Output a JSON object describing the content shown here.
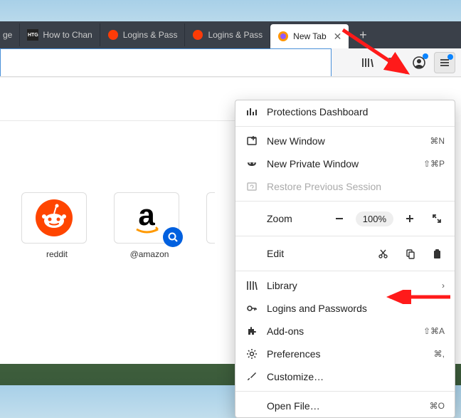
{
  "tabs": [
    {
      "label": "ge",
      "favicon": "generic"
    },
    {
      "label": "How to Chan",
      "favicon": "htg"
    },
    {
      "label": "Logins & Pass",
      "favicon": "firefox"
    },
    {
      "label": "Logins & Pass",
      "favicon": "firefox"
    },
    {
      "label": "New Tab",
      "favicon": "firefox-color",
      "active": true
    }
  ],
  "tiles": [
    {
      "label": "reddit",
      "icon": "reddit"
    },
    {
      "label": "@amazon",
      "icon": "amazon",
      "search": true
    }
  ],
  "zoom": {
    "label": "Zoom",
    "value": "100%"
  },
  "edit": {
    "label": "Edit"
  },
  "menu": {
    "protections": "Protections Dashboard",
    "new_window": {
      "label": "New Window",
      "shortcut": "⌘N"
    },
    "new_private": {
      "label": "New Private Window",
      "shortcut": "⇧⌘P"
    },
    "restore": "Restore Previous Session",
    "library": "Library",
    "logins": "Logins and Passwords",
    "addons": {
      "label": "Add-ons",
      "shortcut": "⇧⌘A"
    },
    "prefs": {
      "label": "Preferences",
      "shortcut": "⌘,"
    },
    "customize": "Customize…",
    "open_file": {
      "label": "Open File…",
      "shortcut": "⌘O"
    }
  }
}
